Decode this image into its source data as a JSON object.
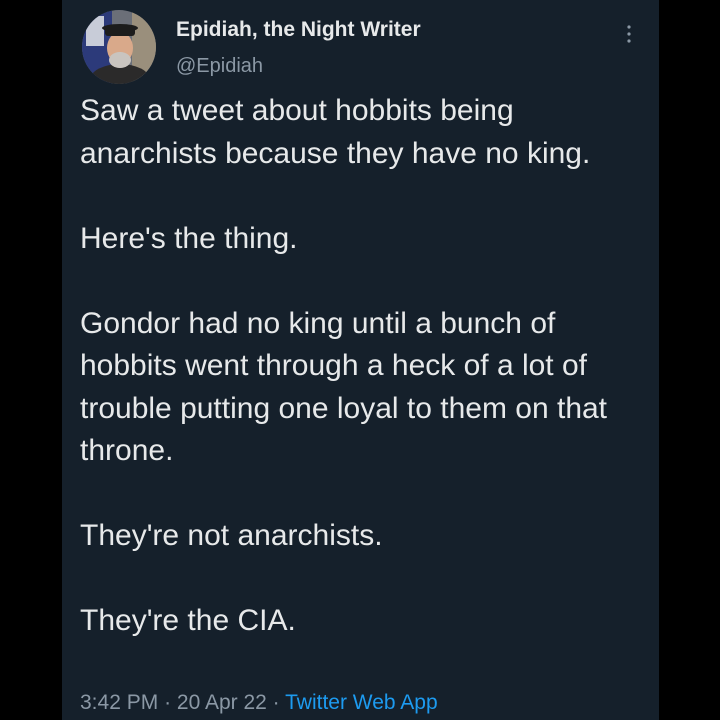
{
  "author": {
    "display_name": "Epidiah, the Night Writer",
    "handle": "@Epidiah",
    "avatar_icon": "profile-photo-avatar"
  },
  "menu": {
    "icon": "more-vertical-icon"
  },
  "tweet": {
    "paragraphs": [
      "Saw a tweet about hobbits being anarchists because they have no king.",
      "Here's the thing.",
      "Gondor had no king until a bunch of hobbits went through a heck of a lot of trouble putting one loyal to them on that throne.",
      "They're not anarchists.",
      "They're the CIA."
    ]
  },
  "meta": {
    "time": "3:42 PM",
    "separator": "·",
    "date": "20 Apr 22",
    "source": "Twitter Web App"
  },
  "colors": {
    "background": "#000000",
    "card": "#15202b",
    "text_primary": "#e7e9ea",
    "text_secondary": "#8b98a5",
    "accent": "#1d9bf0"
  }
}
